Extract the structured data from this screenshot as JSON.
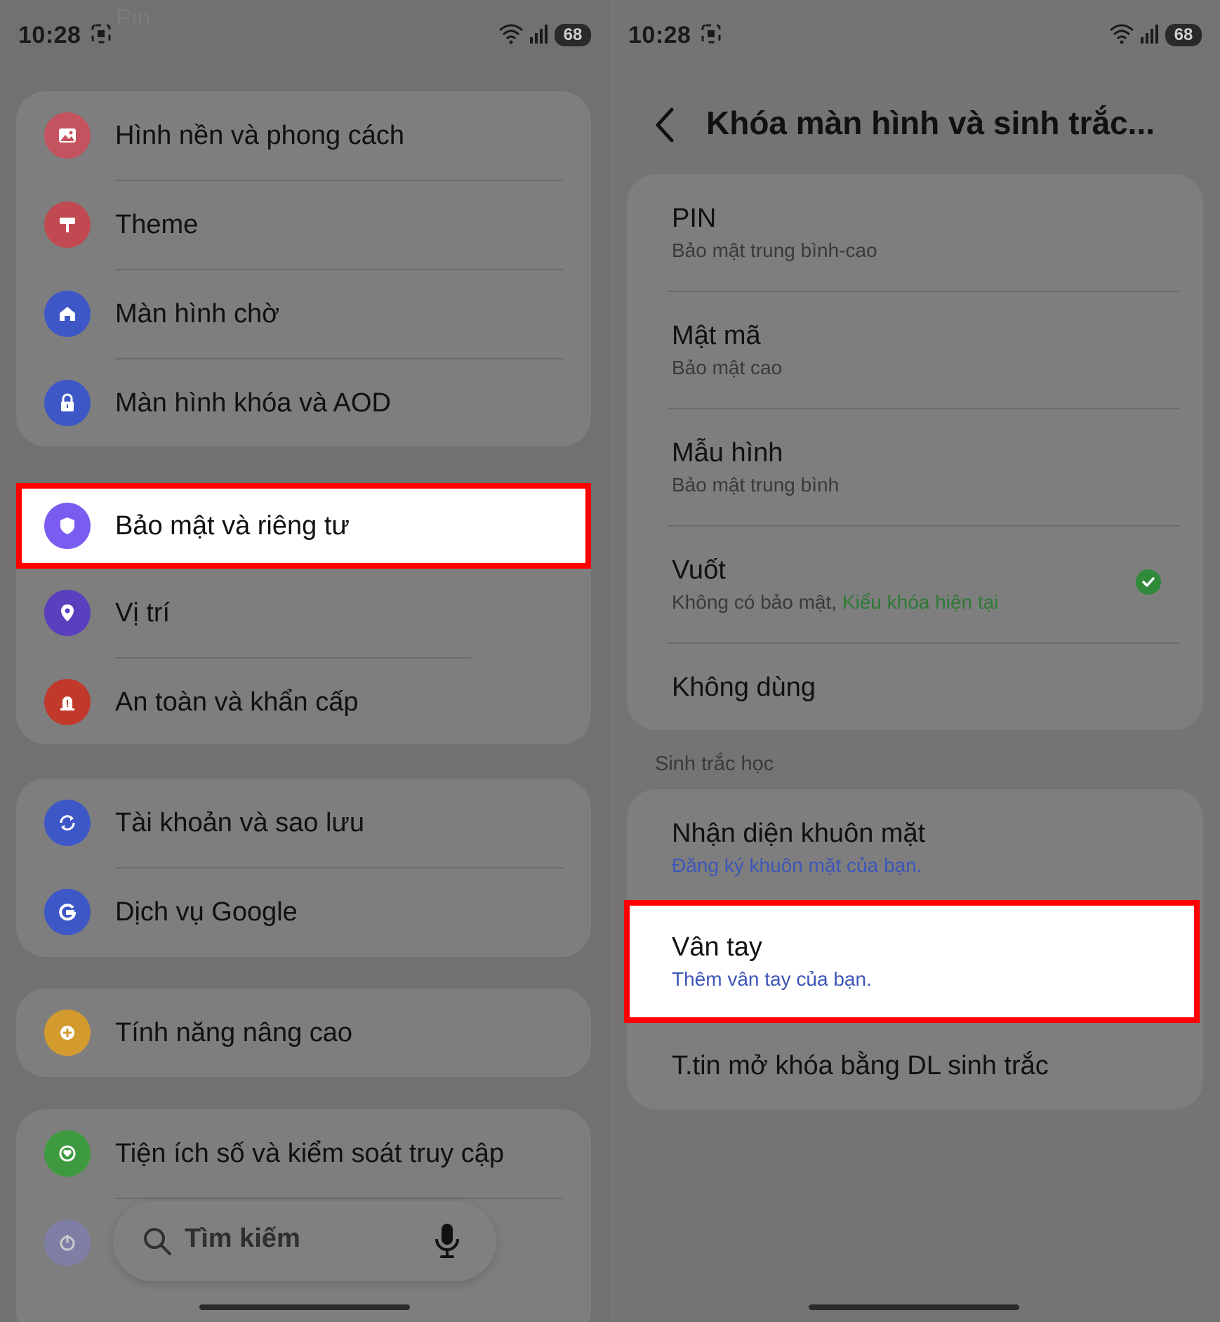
{
  "left": {
    "status": {
      "time": "10:28",
      "battery": "68"
    },
    "ghost_title": "Pin",
    "groups": [
      [
        {
          "label": "Hình nền và phong cách",
          "icon": "image-icon",
          "color": "#c4535f"
        },
        {
          "label": "Theme",
          "icon": "paint-roller-icon",
          "color": "#c14a52"
        },
        {
          "label": "Màn hình chờ",
          "icon": "home-icon",
          "color": "#3e57c7"
        },
        {
          "label": "Màn hình khóa và AOD",
          "icon": "lock-icon",
          "color": "#3e57c7"
        }
      ],
      [
        {
          "label": "Bảo mật và riêng tư",
          "icon": "shield-icon",
          "color": "#7a5cf0",
          "highlighted": true
        },
        {
          "label": "Vị trí",
          "icon": "location-pin-icon",
          "color": "#5a3fbf"
        },
        {
          "label": "An toàn và khẩn cấp",
          "icon": "emergency-siren-icon",
          "color": "#c0392b"
        }
      ],
      [
        {
          "label": "Tài khoản và sao lưu",
          "icon": "sync-icon",
          "color": "#3e57c7"
        },
        {
          "label": "Dịch vụ Google",
          "icon": "google-g-icon",
          "color": "#3e57c7"
        }
      ],
      [
        {
          "label": "Tính năng nâng cao",
          "icon": "gear-plus-icon",
          "color": "#d39a2e"
        }
      ],
      [
        {
          "label": "Tiện ích số và kiểm soát truy cập",
          "icon": "digital-wellbeing-icon",
          "color": "#3e9a3e"
        },
        {
          "label": "",
          "icon": "power-icon",
          "color": "#8080c0"
        }
      ]
    ],
    "search": {
      "placeholder": "Tìm kiếm"
    }
  },
  "right": {
    "status": {
      "time": "10:28",
      "battery": "68"
    },
    "title": "Khóa màn hình và sinh trắc...",
    "lock_types": [
      {
        "title": "PIN",
        "subtitle": "Bảo mật trung bình-cao"
      },
      {
        "title": "Mật mã",
        "subtitle": "Bảo mật cao"
      },
      {
        "title": "Mẫu hình",
        "subtitle": "Bảo mật trung bình"
      },
      {
        "title": "Vuốt",
        "subtitle": "Không có bảo mật, ",
        "subtitle_accent": "Kiểu khóa hiện tại",
        "checked": true
      },
      {
        "title": "Không dùng",
        "subtitle": ""
      }
    ],
    "biometrics_header": "Sinh trắc học",
    "biometrics": [
      {
        "title": "Nhận diện khuôn mặt",
        "subtitle": "Đăng ký khuôn mặt của bạn."
      },
      {
        "title": "Vân tay",
        "subtitle": "Thêm vân tay của bạn.",
        "highlighted": true
      },
      {
        "title": "T.tin mở khóa bằng DL sinh trắc",
        "subtitle": ""
      }
    ],
    "colors": {
      "accent_green": "#2f8a3a",
      "link_blue": "#3d56b8",
      "highlight_border": "#ff0000"
    }
  }
}
